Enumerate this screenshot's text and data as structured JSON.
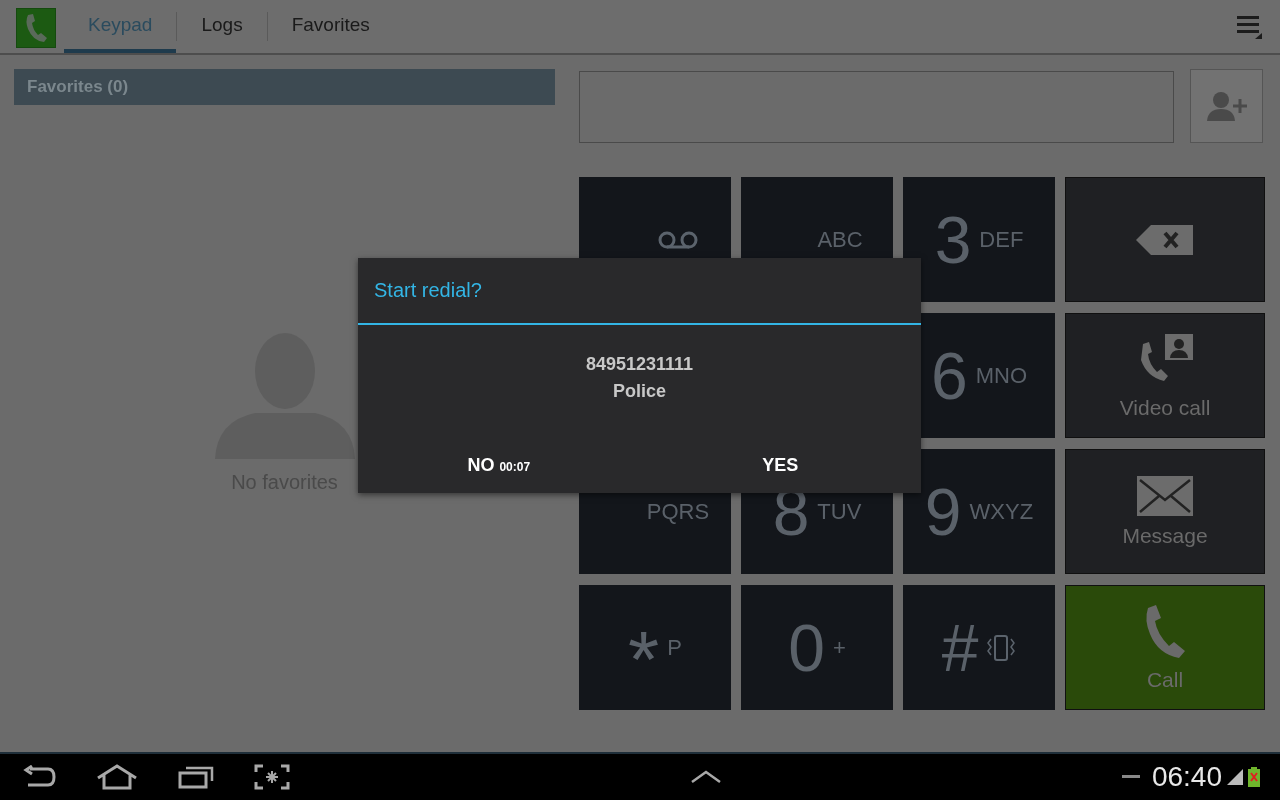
{
  "tabs": [
    {
      "label": "Keypad",
      "selected": true
    },
    {
      "label": "Logs",
      "selected": false
    },
    {
      "label": "Favorites",
      "selected": false
    }
  ],
  "favorites": {
    "header": "Favorites (0)",
    "empty_text": "No favorites"
  },
  "keys": [
    {
      "kind": "voicemail"
    },
    {
      "letters": "ABC",
      "kind": "letters"
    },
    {
      "digit": "3",
      "letters": "DEF",
      "kind": "letters"
    },
    {
      "kind": "covered"
    },
    {
      "kind": "covered"
    },
    {
      "digit": "6",
      "letters": "MNO",
      "kind": "letters"
    },
    {
      "letters": "PQRS",
      "kind": "letters"
    },
    {
      "digit": "8",
      "letters": "TUV",
      "kind": "letters"
    },
    {
      "digit": "9",
      "letters": "WXYZ",
      "kind": "letters"
    },
    {
      "digit": "*",
      "letters": "P",
      "kind": "star"
    },
    {
      "digit": "0",
      "letters": "+",
      "kind": "letters"
    },
    {
      "digit": "#",
      "kind": "vibrate"
    }
  ],
  "actions": [
    {
      "kind": "delete"
    },
    {
      "kind": "video",
      "label": "Video call"
    },
    {
      "kind": "message",
      "label": "Message"
    },
    {
      "kind": "call",
      "label": "Call"
    }
  ],
  "dialog": {
    "title": "Start redial?",
    "number": "84951231111",
    "name": "Police",
    "no": "NO",
    "countdown": "00:07",
    "yes": "YES"
  },
  "status_bar": {
    "time": "06:40"
  }
}
